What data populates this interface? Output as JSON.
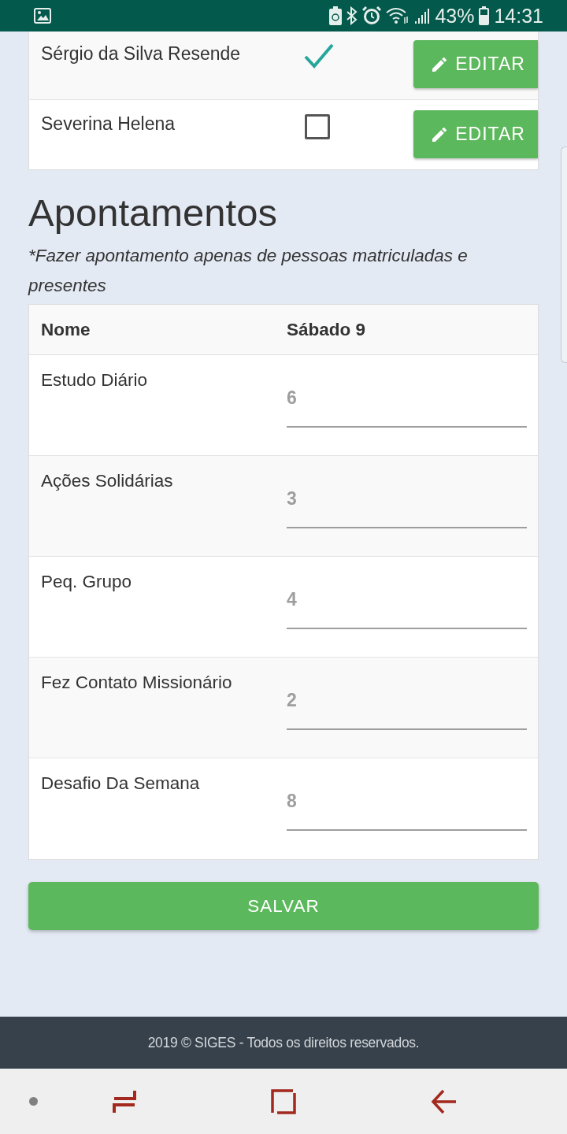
{
  "status_bar": {
    "battery": "43%",
    "time": "14:31"
  },
  "attendance": {
    "rows": [
      {
        "name": "Sérgio da Silva Resende",
        "checked": true,
        "action": "EDITAR"
      },
      {
        "name": "Severina Helena",
        "checked": false,
        "action": "EDITAR"
      }
    ]
  },
  "section": {
    "title": "Apontamentos",
    "note": "*Fazer apontamento apenas de pessoas matriculadas e presentes"
  },
  "table": {
    "columns": [
      "Nome",
      "Sábado 9"
    ],
    "rows": [
      {
        "label": "Estudo Diário",
        "value": "6"
      },
      {
        "label": "Ações Solidárias",
        "value": "3"
      },
      {
        "label": "Peq. Grupo",
        "value": "4"
      },
      {
        "label": "Fez Contato Missionário",
        "value": "2"
      },
      {
        "label": "Desafio Da Semana",
        "value": "8"
      }
    ]
  },
  "save_button": "SALVAR",
  "footer": "2019 © SIGES - Todos os direitos reservados."
}
